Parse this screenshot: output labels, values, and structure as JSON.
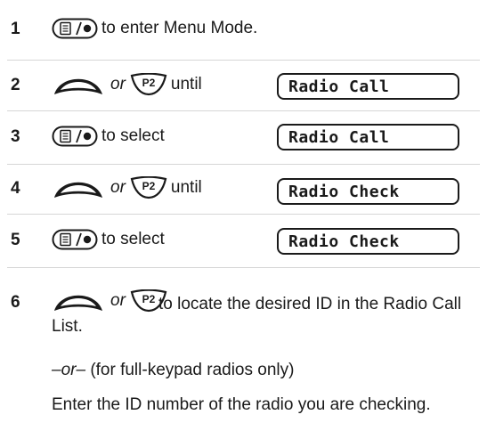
{
  "steps": [
    {
      "num": "1",
      "text": "to enter Menu Mode."
    },
    {
      "num": "2",
      "or": "or",
      "text": "until",
      "display": "Radio Call"
    },
    {
      "num": "3",
      "text": "to select",
      "display": "Radio Call"
    },
    {
      "num": "4",
      "or": "or",
      "text": "until",
      "display": "Radio Check"
    },
    {
      "num": "5",
      "text": "to select",
      "display": "Radio Check"
    },
    {
      "num": "6",
      "or": "or",
      "text": "to locate the desired ID in the Radio Call List."
    }
  ],
  "alt": {
    "or_label": "–or–",
    "note": "(for full-keypad radios only)"
  },
  "enter_text": "Enter the ID number of the radio you are checking.",
  "icons": {
    "menu_key": "menu-select-key-icon",
    "up_key": "up-scroll-key-icon",
    "p2_key": "p2-key-icon"
  }
}
